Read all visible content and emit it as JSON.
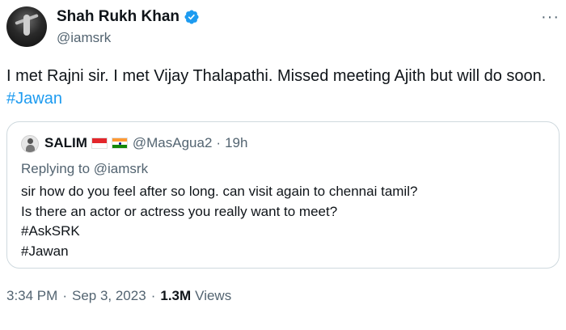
{
  "author": {
    "name": "Shah Rukh Khan",
    "handle": "@iamsrk",
    "verified": true,
    "more_label": "···"
  },
  "tweet": {
    "text": "I met Rajni sir. I met Vijay Thalapathi. Missed meeting Ajith but will do soon. ",
    "hashtag": "#Jawan"
  },
  "quoted_tweet": {
    "name": "SALIM",
    "flags": [
      "indonesia-flag",
      "india-flag"
    ],
    "handle": "@MasAgua2",
    "separator": "·",
    "time": "19h",
    "replying_to": "Replying to @iamsrk",
    "lines": [
      "sir how do you feel after so long. can visit again to chennai tamil?",
      "Is there an actor or actress you really want to meet?",
      "#AskSRK",
      "#Jawan"
    ]
  },
  "meta": {
    "time": "3:34 PM",
    "separator": "·",
    "date": "Sep 3, 2023",
    "views_count": "1.3M",
    "views_label": "Views"
  },
  "colors": {
    "link": "#1d9bf0",
    "secondary_text": "#536471",
    "border": "#cfd9de"
  }
}
